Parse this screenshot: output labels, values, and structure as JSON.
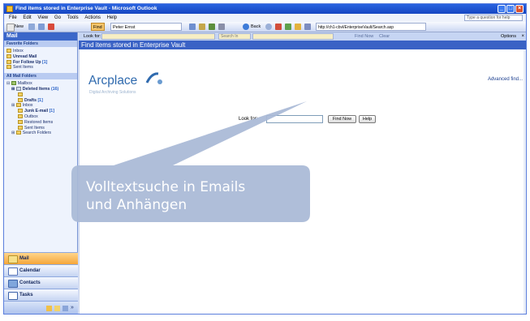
{
  "window": {
    "title": "Find items stored in Enterprise Vault - Microsoft Outlook"
  },
  "menubar": {
    "items": [
      "File",
      "Edit",
      "View",
      "Go",
      "Tools",
      "Actions",
      "Help"
    ],
    "help_placeholder": "Type a question for help"
  },
  "toolbar": {
    "new_label": "New",
    "find_label": "Find",
    "address_label": "Peter Ernst",
    "back_label": "Back",
    "url_value": "http://ch1-cbvl/EnterpriseVault/Search.asp"
  },
  "left_pane": {
    "header": "Mail",
    "favorites_label": "Favorite Folders",
    "favorites": [
      {
        "label": "Inbox",
        "count": ""
      },
      {
        "label": "Unread Mail",
        "count": ""
      },
      {
        "label": "For Follow Up",
        "count": "[1]"
      },
      {
        "label": "Sent Items",
        "count": ""
      }
    ],
    "all_folders_label": "All Mail Folders",
    "mailbox_label": "Mailbox",
    "folders": [
      {
        "label": "Deleted Items",
        "count": "(16)",
        "bold": true
      },
      {
        "label": "Drafts",
        "count": "[1]",
        "bold": true
      },
      {
        "label": "Inbox",
        "count": "",
        "bold": false
      },
      {
        "label": "Junk E-mail",
        "count": "[1]",
        "bold": true
      },
      {
        "label": "Outbox",
        "count": "",
        "bold": false
      },
      {
        "label": "Restored Items",
        "count": "",
        "bold": false
      },
      {
        "label": "Sent Items",
        "count": "",
        "bold": false
      },
      {
        "label": "Search Folders",
        "count": "",
        "bold": false
      }
    ],
    "nav": [
      "Mail",
      "Calendar",
      "Contacts",
      "Tasks"
    ]
  },
  "lookbar": {
    "look_for_label": "Look for:",
    "search_in_label": "Search In",
    "find_now_label": "Find Now",
    "clear_label": "Clear",
    "options_label": "Options"
  },
  "content": {
    "pane_title": "Find items stored in Enterprise Vault",
    "logo_word": "Arcplace",
    "logo_tagline": "Digital Archiving Solutions",
    "advanced_find": "Advanced find...",
    "search_label": "Look for:",
    "search_value": "",
    "find_button": "Find Now",
    "help_button": "Help"
  },
  "callout": {
    "line1": "Volltextsuche in Emails",
    "line2": "und Anhängen"
  },
  "colors": {
    "brand_blue": "#3a62c5",
    "callout_fill": "#a9b9d6",
    "arcplace_blue": "#2f6aae"
  }
}
